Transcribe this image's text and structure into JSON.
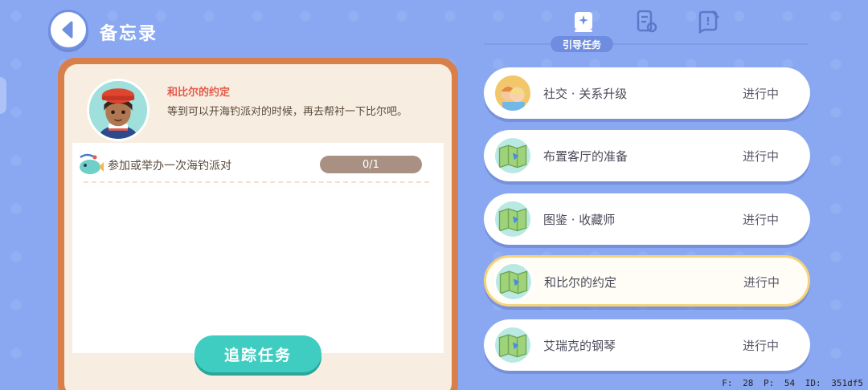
{
  "header": {
    "title": "备忘录"
  },
  "memo": {
    "task_name": "和比尔的约定",
    "description": "等到可以开海钓派对的时候，再去帮衬一下比尔吧。",
    "objective": {
      "text": "参加或举办一次海钓派对",
      "progress": "0/1"
    },
    "track_button": "追踪任务"
  },
  "tabs": {
    "active_label": "引导任务",
    "icons": [
      "guide-task-icon",
      "notes-icon",
      "question-notes-icon"
    ]
  },
  "tasks": [
    {
      "name": "社交 · 关系升级",
      "status": "进行中",
      "icon": "friends-icon",
      "selected": false
    },
    {
      "name": "布置客厅的准备",
      "status": "进行中",
      "icon": "map-icon",
      "selected": false
    },
    {
      "name": "图鉴 · 收藏师",
      "status": "进行中",
      "icon": "map-icon",
      "selected": false
    },
    {
      "name": "和比尔的约定",
      "status": "进行中",
      "icon": "map-icon",
      "selected": true
    },
    {
      "name": "艾瑞克的钢琴",
      "status": "进行中",
      "icon": "map-icon",
      "selected": false
    }
  ],
  "debug": {
    "text": "F: 28    P: 54    ID: 351df5"
  },
  "colors": {
    "background": "#8aa8f2",
    "card_border": "#d9804a",
    "accent_button": "#3ecdc0",
    "selected_border": "#f5d37a",
    "task_title": "#e55a4a"
  }
}
